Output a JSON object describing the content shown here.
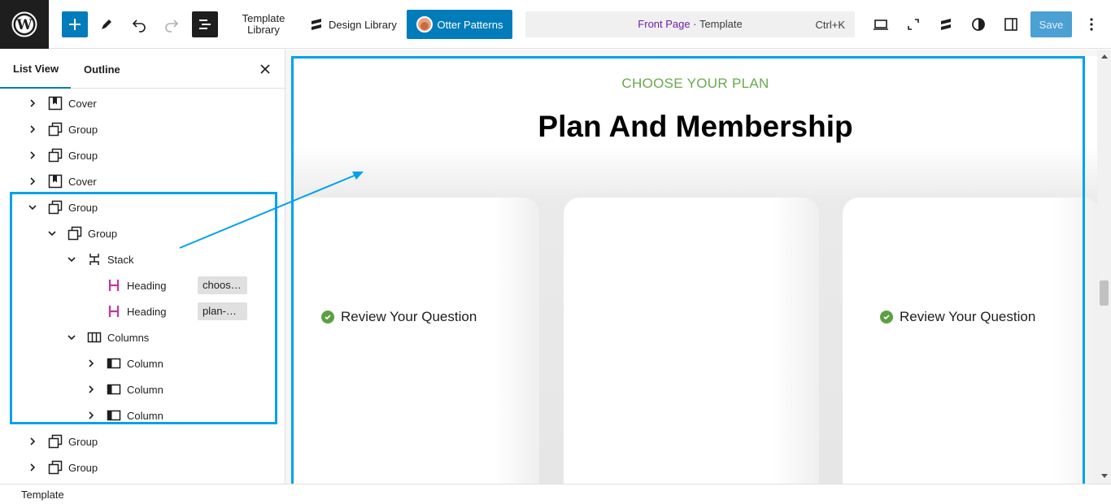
{
  "toolbar": {
    "template_library": "Template Library",
    "design_library": "Design Library",
    "otter_patterns": "Otter Patterns",
    "command": {
      "page": "Front Page",
      "separator": " · ",
      "type": "Template",
      "shortcut": "Ctrl+K"
    },
    "save": "Save"
  },
  "sidebar": {
    "tabs": [
      "List View",
      "Outline"
    ],
    "tree": [
      {
        "label": "Cover",
        "icon": "cover-icon",
        "depth": 0,
        "expanded": false
      },
      {
        "label": "Group",
        "icon": "group-icon",
        "depth": 0,
        "expanded": false
      },
      {
        "label": "Group",
        "icon": "group-icon",
        "depth": 0,
        "expanded": false
      },
      {
        "label": "Cover",
        "icon": "cover-icon",
        "depth": 0,
        "expanded": false
      },
      {
        "label": "Group",
        "icon": "group-icon",
        "depth": 0,
        "expanded": true
      },
      {
        "label": "Group",
        "icon": "group-icon",
        "depth": 1,
        "expanded": true
      },
      {
        "label": "Stack",
        "icon": "stack-icon",
        "depth": 2,
        "expanded": true
      },
      {
        "label": "Heading",
        "icon": "heading-icon",
        "depth": 3,
        "anchor": "choos…"
      },
      {
        "label": "Heading",
        "icon": "heading-icon",
        "depth": 3,
        "anchor": "plan-…"
      },
      {
        "label": "Columns",
        "icon": "columns-icon",
        "depth": 2,
        "expanded": true
      },
      {
        "label": "Column",
        "icon": "column-icon",
        "depth": 3,
        "expanded": false
      },
      {
        "label": "Column",
        "icon": "column-icon",
        "depth": 3,
        "expanded": false
      },
      {
        "label": "Column",
        "icon": "column-icon",
        "depth": 3,
        "expanded": false
      },
      {
        "label": "Group",
        "icon": "group-icon",
        "depth": 0,
        "expanded": false
      },
      {
        "label": "Group",
        "icon": "group-icon",
        "depth": 0,
        "expanded": false
      }
    ]
  },
  "canvas": {
    "eyebrow": "CHOOSE YOUR PLAN",
    "heading": "Plan And Membership",
    "features": [
      "Review Your Question",
      "Review Your Question"
    ]
  },
  "footer": {
    "breadcrumb": "Template"
  },
  "colors": {
    "accent": "#007cba",
    "highlight": "#00a2e8",
    "eyebrow": "#6aa84f",
    "heading_icon": "#c2359e"
  }
}
